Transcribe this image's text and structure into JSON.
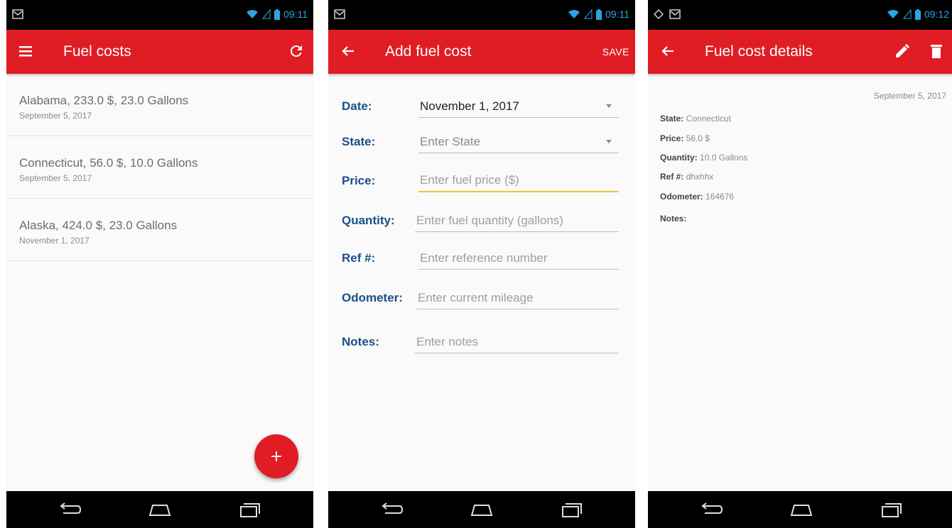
{
  "status_bar": {
    "time_phone1": "09:11",
    "time_phone2": "09:11",
    "time_phone3": "09:12"
  },
  "screen_list": {
    "title": "Fuel costs",
    "items": [
      {
        "title": "Alabama,  233.0 $, 23.0 Gallons",
        "date": "September 5, 2017"
      },
      {
        "title": "Connecticut,  56.0 $, 10.0 Gallons",
        "date": "September 5, 2017"
      },
      {
        "title": "Alaska,  424.0 $, 23.0 Gallons",
        "date": "November 1, 2017"
      }
    ],
    "fab_label": "+"
  },
  "screen_add": {
    "title": "Add fuel cost",
    "save_label": "SAVE",
    "fields": {
      "date": {
        "label": "Date:",
        "value": "November 1, 2017"
      },
      "state": {
        "label": "State:",
        "placeholder": "Enter State"
      },
      "price": {
        "label": "Price:",
        "placeholder": "Enter fuel price ($)"
      },
      "quantity": {
        "label": "Quantity:",
        "placeholder": "Enter fuel quantity (gallons)"
      },
      "ref": {
        "label": "Ref #:",
        "placeholder": "Enter reference number"
      },
      "odometer": {
        "label": "Odometer:",
        "placeholder": "Enter current mileage"
      },
      "notes": {
        "label": "Notes:",
        "placeholder": "Enter notes"
      }
    }
  },
  "screen_details": {
    "title": "Fuel cost details",
    "date": "September 5, 2017",
    "rows": {
      "state": {
        "key": "State:",
        "value": "Connecticut"
      },
      "price": {
        "key": "Price:",
        "value": "56.0 $"
      },
      "quantity": {
        "key": "Quantity:",
        "value": "10.0 Gallons"
      },
      "ref": {
        "key": "Ref #:",
        "value": "dhxhhx"
      },
      "odometer": {
        "key": "Odometer:",
        "value": "164676"
      },
      "notes": {
        "key": "Notes:",
        "value": ""
      }
    }
  },
  "colors": {
    "app_bar": "#e01d24",
    "label_blue": "#1a4f86",
    "focus_underline": "#e8c43c",
    "status_time": "#2aa7e0"
  },
  "icons": [
    "menu-icon",
    "refresh-icon",
    "back-arrow-icon",
    "edit-icon",
    "delete-icon",
    "add-icon",
    "nav-back-icon",
    "nav-home-icon",
    "nav-recents-icon",
    "wifi-icon",
    "signal-icon",
    "battery-icon",
    "gmail-icon",
    "gallery-icon"
  ]
}
